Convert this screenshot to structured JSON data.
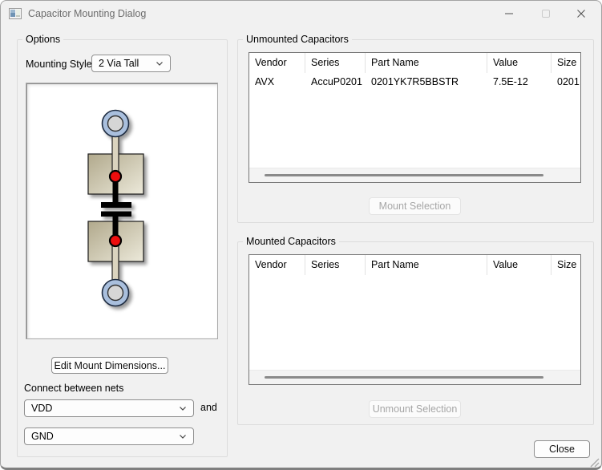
{
  "window": {
    "title": "Capacitor Mounting Dialog"
  },
  "options": {
    "title": "Options",
    "mounting_style_label": "Mounting Style:",
    "mounting_style_value": "2 Via Tall",
    "edit_mount_dimensions_button": "Edit Mount Dimensions...",
    "connect_between_nets_label": "Connect between nets",
    "net_top_value": "VDD",
    "and_label": "and",
    "net_bottom_value": "GND"
  },
  "unmounted_capacitors": {
    "title": "Unmounted Capacitors",
    "columns": [
      "Vendor",
      "Series",
      "Part Name",
      "Value",
      "Size"
    ],
    "rows": [
      [
        "AVX",
        "AccuP0201",
        "0201YK7R5BBSTR",
        "7.5E-12",
        "0201"
      ]
    ],
    "mount_button": "Mount Selection"
  },
  "mounted_capacitors": {
    "title": "Mounted Capacitors",
    "columns": [
      "Vendor",
      "Series",
      "Part Name",
      "Value",
      "Size"
    ],
    "rows": [],
    "unmount_button": "Unmount Selection"
  },
  "footer": {
    "close_button": "Close"
  },
  "colors": {
    "via_ring": "#a9bfdd",
    "via_hole": "#d6d6d6",
    "pad_dark": "#b1a98c",
    "pad_light": "#ece9da",
    "trace": "#dbd4bf",
    "junction_dot": "#ee1111",
    "capacitor_symbol": "#000000"
  }
}
